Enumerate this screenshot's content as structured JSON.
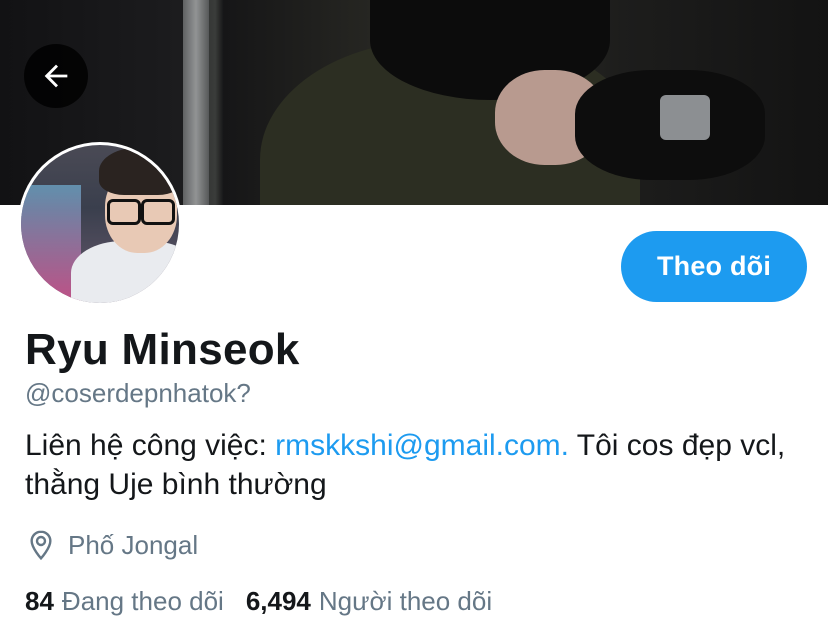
{
  "header": {
    "back_icon": "arrow-left-icon"
  },
  "profile": {
    "name": "Ryu Minseok",
    "handle": "@coserdepnhatok?",
    "bio_prefix": "Liên hệ công việc: ",
    "bio_link": "rmskkshi@gmail.com.",
    "bio_suffix": " Tôi cos đẹp vcl, thằng Uje bình thường",
    "location": "Phố Jongal",
    "location_icon": "map-pin-icon",
    "follow_label": "Theo dõi"
  },
  "stats": {
    "following_count": "84",
    "following_label": "Đang theo dõi",
    "followers_count": "6,494",
    "followers_label": "Người theo dõi"
  },
  "colors": {
    "accent": "#1d9bf0",
    "muted": "#657786",
    "text": "#14171a"
  }
}
